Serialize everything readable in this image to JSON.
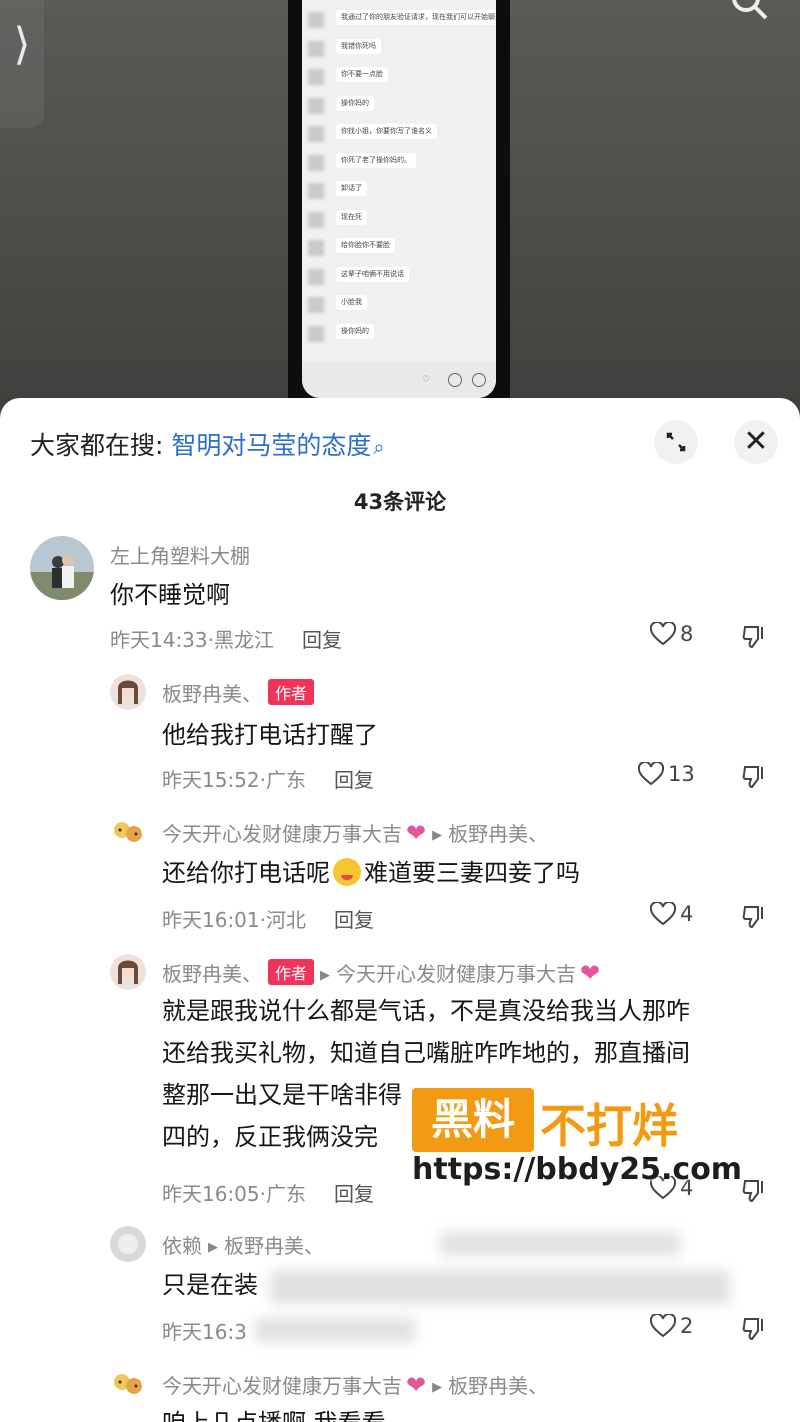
{
  "video": {
    "chat_lines": [
      "我通过了你的朋友验证请求，现在我们可以开始聊天了",
      "我错你死吗",
      "你不要一点脸",
      "操你妈的",
      "你找小姐，你要你写了谁名义",
      "你死了老了操你妈的。",
      "卸话了",
      "现在死",
      "给你脸你不要脸",
      "这辈子咱俩不用说话",
      "小脸我",
      "操你妈的"
    ]
  },
  "sheet": {
    "search_prefix": "大家都在搜:",
    "search_keyword": "智明对马莹的态度",
    "comment_count": "43条评论"
  },
  "comments": [
    {
      "user": "左上角塑料大棚",
      "text": "你不睡觉啊",
      "time": "昨天14:33·黑龙江",
      "reply": "回复",
      "likes": "8"
    },
    {
      "user": "板野冉美、",
      "badge": "作者",
      "text": "他给我打电话打醒了",
      "time": "昨天15:52·广东",
      "reply": "回复",
      "likes": "13"
    },
    {
      "user": "今天开心发财健康万事大吉",
      "reply_to": "板野冉美、",
      "text_before": "还给你打电话呢",
      "text_after": "难道要三妻四妾了吗",
      "time": "昨天16:01·河北",
      "reply": "回复",
      "likes": "4"
    },
    {
      "user": "板野冉美、",
      "badge": "作者",
      "reply_to": "今天开心发财健康万事大吉",
      "lines": [
        "就是跟我说什么都是气话，不是真没给我当人那咋",
        "还给我买礼物，知道自己嘴脏咋咋地的，那直播间",
        "整那一出又是干啥非得",
        "四的，反正我俩没完"
      ],
      "time": "昨天16:05·广东",
      "reply": "回复",
      "likes": "4"
    },
    {
      "user": "依赖",
      "reply_to": "板野冉美、",
      "text": "只是在装",
      "time": "昨天16:3",
      "reply": "",
      "likes": "2"
    },
    {
      "user": "今天开心发财健康万事大吉",
      "reply_to": "板野冉美、",
      "text": "咱上几点播啊 我看看"
    }
  ],
  "watermark": {
    "box": "黑料",
    "text": "不打烊",
    "url": "https://bbdy25.com"
  },
  "colors": {
    "keyword": "#2a6fc9",
    "badge": "#f0335a",
    "watermark": "#f29a11"
  }
}
